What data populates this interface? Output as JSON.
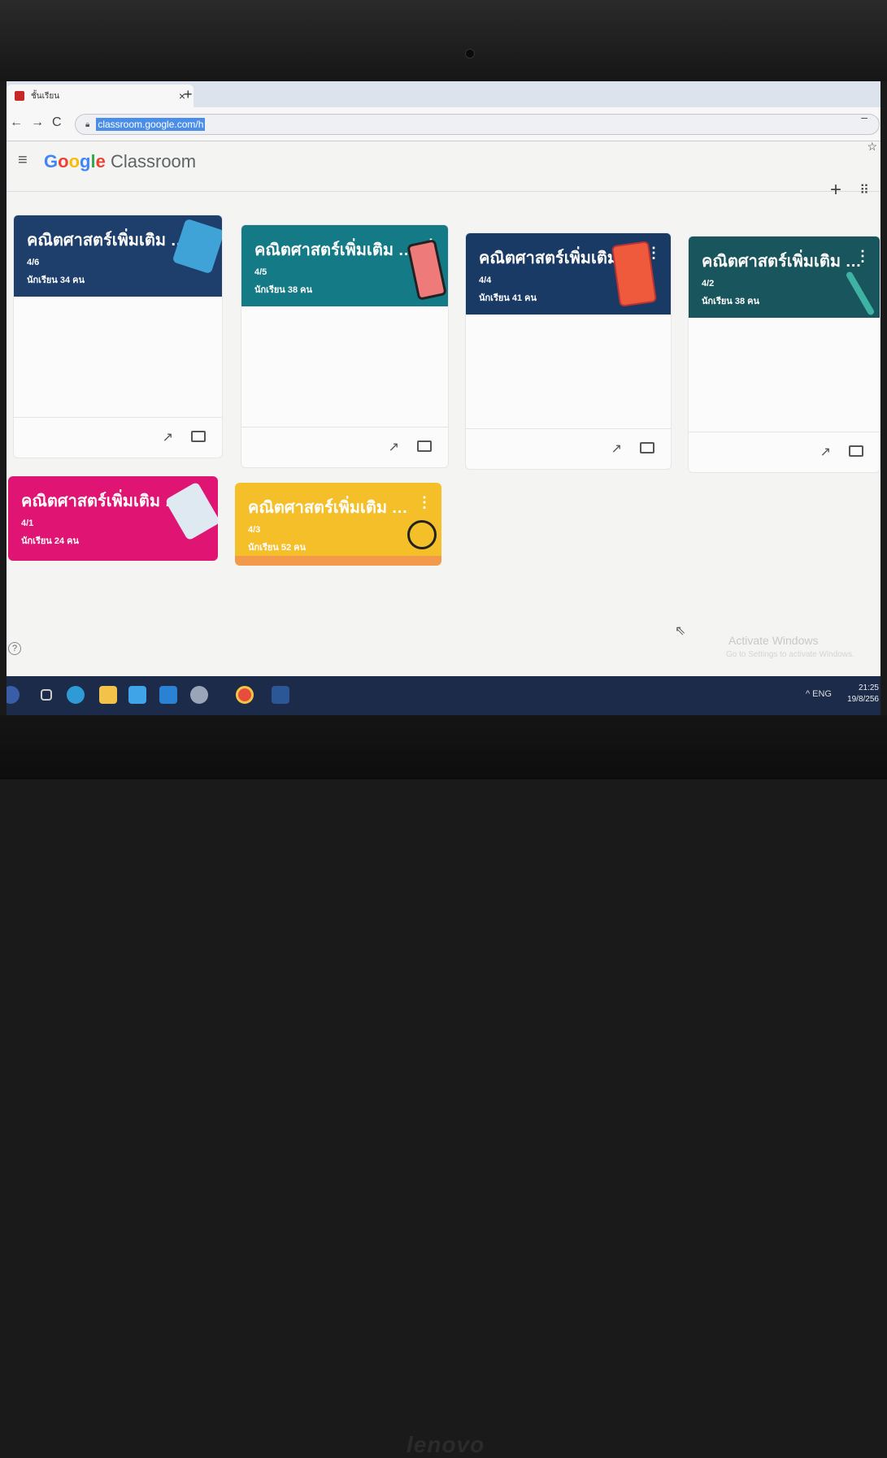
{
  "browser": {
    "tab_title": "ชั้นเรียน",
    "tab_close": "×",
    "new_tab": "+",
    "back": "←",
    "forward": "→",
    "reload": "C",
    "url": "classroom.google.com/h",
    "star": "☆",
    "minimize": "–"
  },
  "header": {
    "menu": "≡",
    "logo_google": [
      "G",
      "o",
      "o",
      "g",
      "l",
      "e"
    ],
    "logo_product": "Classroom",
    "add": "+",
    "apps": "⠿"
  },
  "cards": [
    {
      "title": "คณิตศาสตร์เพิ่มเติม ค3...",
      "section": "4/6",
      "students": "นักเรียน 34 คน",
      "color": "#1e3f6b"
    },
    {
      "title": "คณิตศาสตร์เพิ่มเติม ค3...",
      "section": "4/5",
      "students": "นักเรียน 38 คน",
      "color": "#147a86"
    },
    {
      "title": "คณิตศาสตร์เพิ่มเติม ค3...",
      "section": "4/4",
      "students": "นักเรียน 41 คน",
      "color": "#1a3a66"
    },
    {
      "title": "คณิตศาสตร์เพิ่มเติม ค 3...",
      "section": "4/2",
      "students": "นักเรียน 38 คน",
      "color": "#18555c"
    },
    {
      "title": "คณิตศาสตร์เพิ่มเติม ค 3...",
      "section": "4/1",
      "students": "นักเรียน 24 คน",
      "color": "#e01573"
    },
    {
      "title": "คณิตศาสตร์เพิ่มเติม ค3...",
      "section": "4/3",
      "students": "นักเรียน 52 คน",
      "color": "#f5bf2a"
    }
  ],
  "card_icons": {
    "more": "⋮",
    "trend": "↗"
  },
  "watermark": {
    "title": "Activate Windows",
    "subtitle": "Go to Settings to activate Windows."
  },
  "help": "?",
  "tray": {
    "text": "^ ENG",
    "time": "21:25",
    "date": "19/8/256"
  },
  "laptop_brand": "lenovo"
}
